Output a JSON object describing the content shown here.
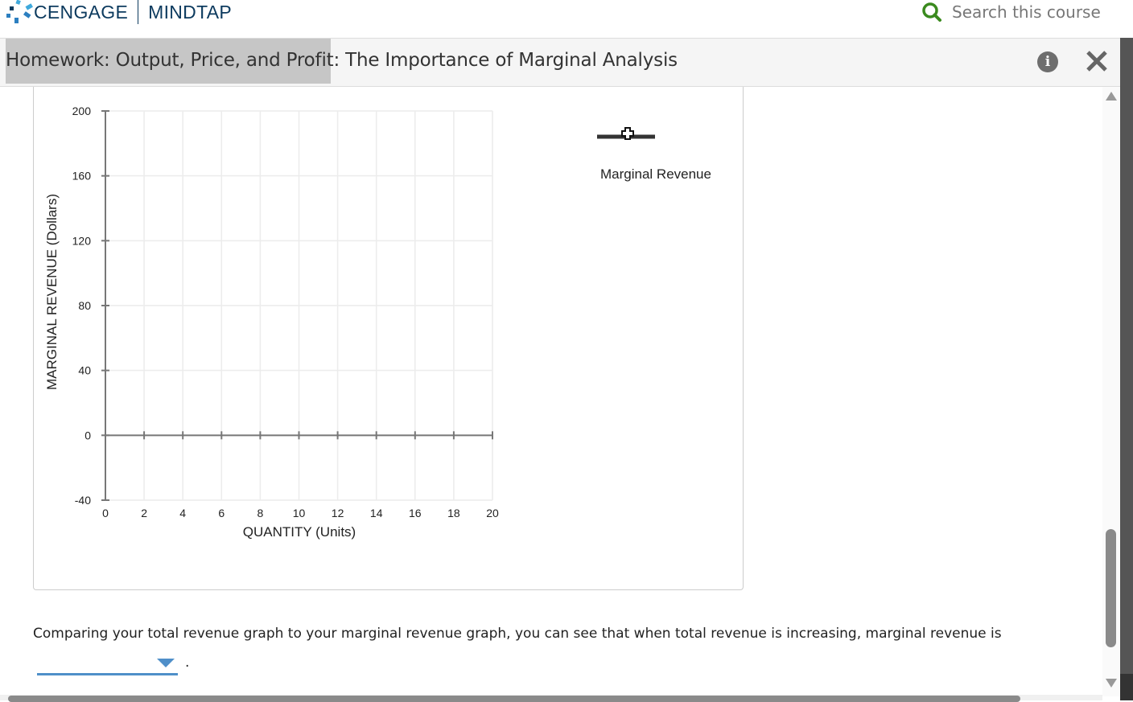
{
  "header": {
    "brand_primary": "CENGAGE",
    "brand_secondary": "MINDTAP",
    "search_placeholder": "Search this course",
    "search_icon": "search-icon"
  },
  "titlebar": {
    "title": "Homework: Output, Price, and Profit: The Importance of Marginal Analysis",
    "info_icon": "info-icon",
    "info_glyph": "i",
    "close_icon": "close-icon"
  },
  "colors": {
    "brand": "#0c3a5e",
    "search_icon": "#3a8a1e",
    "dropdown_accent": "#4f8fc9",
    "legend_line": "#333333"
  },
  "chart_data": {
    "type": "line",
    "title": "",
    "xlabel": "QUANTITY (Units)",
    "ylabel": "MARGINAL REVENUE (Dollars)",
    "xlim": [
      0,
      20
    ],
    "ylim": [
      -40,
      200
    ],
    "x_ticks": [
      "0",
      "2",
      "4",
      "6",
      "8",
      "10",
      "12",
      "14",
      "16",
      "18",
      "20"
    ],
    "y_ticks": [
      "200",
      "160",
      "120",
      "80",
      "40",
      "0",
      "-40"
    ],
    "grid": true,
    "legend_position": "right",
    "series": [
      {
        "name": "Marginal Revenue",
        "marker": "cross",
        "points": []
      }
    ]
  },
  "question": {
    "text": "Comparing your total revenue graph to your marginal revenue graph, you can see that when total revenue is increasing, marginal revenue is",
    "dropdown_selected": "",
    "trailing": "."
  }
}
